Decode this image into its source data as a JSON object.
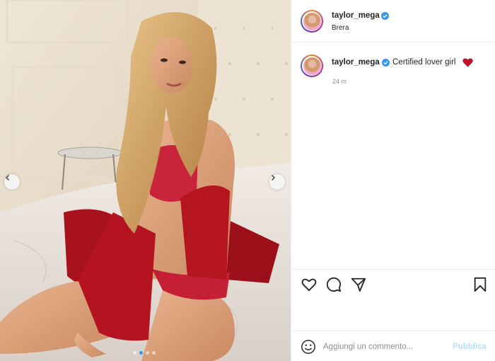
{
  "post": {
    "username": "taylor_mega",
    "location": "Brera",
    "caption": {
      "username": "taylor_mega",
      "text": "Certified lover girl",
      "emoji": "heart-icon"
    },
    "timestamp": "24 m",
    "carousel": {
      "slide_count": 4,
      "active_slide": 2
    }
  },
  "comment_box": {
    "placeholder": "Aggiungi un commento...",
    "publish_label": "Pubblica"
  },
  "icons": {
    "like": "heart-outline-icon",
    "comment": "comment-bubble-icon",
    "share": "paper-plane-icon",
    "save": "bookmark-icon",
    "emoji": "smiley-icon",
    "verified": "verified-badge-icon",
    "prev": "chevron-left-icon",
    "next": "chevron-right-icon"
  },
  "colors": {
    "verified": "#3897f0",
    "publish_disabled": "#b2dffc",
    "text": "#262626",
    "muted": "#8e8e8e",
    "heart_emoji": "#c8102e"
  }
}
